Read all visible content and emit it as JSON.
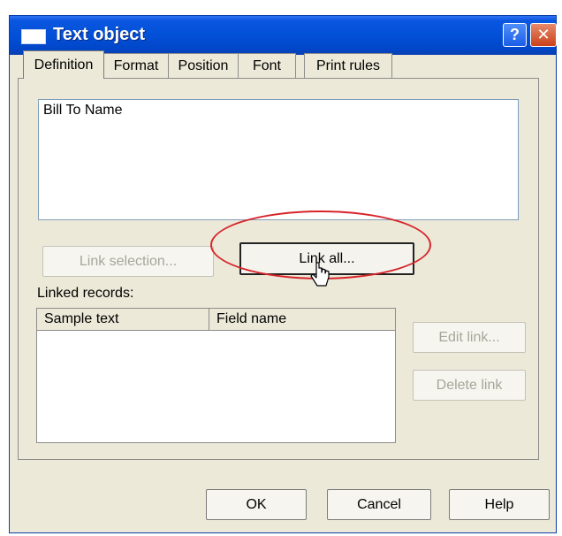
{
  "window": {
    "title": "Text object",
    "help_glyph": "?",
    "close_glyph": "✕"
  },
  "tabs": [
    {
      "label": "Definition",
      "active": true
    },
    {
      "label": "Format",
      "active": false
    },
    {
      "label": "Position",
      "active": false
    },
    {
      "label": "Font",
      "active": false
    },
    {
      "label": "Print rules",
      "active": false
    }
  ],
  "definition": {
    "text_value": "Bill To Name"
  },
  "buttons": {
    "link_selection": "Link selection...",
    "link_all": "Link all...",
    "edit_link": "Edit link...",
    "delete_link": "Delete link"
  },
  "linked_records": {
    "label": "Linked records:",
    "columns": [
      "Sample text",
      "Field name"
    ],
    "rows": []
  },
  "footer": {
    "ok": "OK",
    "cancel": "Cancel",
    "help": "Help"
  },
  "colors": {
    "titlebar": "#0350d8",
    "dialog_face": "#ece9d8",
    "annotation_circle": "#d8242a"
  },
  "icons": {
    "title_icon": "window-icon",
    "cursor": "mouse-pointer-icon"
  }
}
